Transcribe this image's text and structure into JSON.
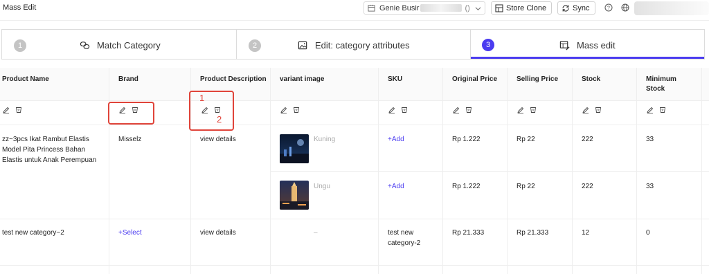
{
  "app": {
    "title": "Mass Edit",
    "store_select_value": "Genie Busir",
    "store_select_suffix": "()",
    "store_clone_label": "Store Clone",
    "sync_label": "Sync"
  },
  "steps": [
    {
      "num": "1",
      "label": "Match Category",
      "icon": "match-category-icon",
      "active": false
    },
    {
      "num": "2",
      "label": "Edit: category attributes",
      "icon": "image-edit-icon",
      "active": false
    },
    {
      "num": "3",
      "label": "Mass edit",
      "icon": "table-edit-icon",
      "active": true
    }
  ],
  "columns": [
    {
      "label": "Product Name"
    },
    {
      "label": "Brand"
    },
    {
      "label": "Product Description"
    },
    {
      "label": "variant image"
    },
    {
      "label": "SKU"
    },
    {
      "label": "Original Price"
    },
    {
      "label": "Selling Price"
    },
    {
      "label": "Stock"
    },
    {
      "label": "Minimum Stock"
    }
  ],
  "rows": [
    {
      "product_name": "zz~3pcs Ikat Rambut Elastis Model Pita Princess Bahan Elastis untuk Anak Perempuan",
      "brand": "Misselz",
      "description": "view details",
      "variants": [
        {
          "image_label": "Kuning",
          "sku": "+Add",
          "original_price": "Rp 1.222",
          "selling_price": "Rp 22",
          "stock": "222",
          "min_stock": "33"
        },
        {
          "image_label": "Ungu",
          "sku": "+Add",
          "original_price": "Rp 1.222",
          "selling_price": "Rp 22",
          "stock": "222",
          "min_stock": "33"
        }
      ]
    },
    {
      "product_name": "test new category~2",
      "brand": "+Select",
      "description": "view details",
      "variants": [
        {
          "image_label": "–",
          "sku": "test new category-2",
          "original_price": "Rp 21.333",
          "selling_price": "Rp 21.333",
          "stock": "12",
          "min_stock": "0"
        }
      ]
    }
  ],
  "annotations": {
    "box1": "1",
    "box2": "2"
  },
  "colors": {
    "accent": "#4b3cf0",
    "annotation": "#e0443a"
  }
}
